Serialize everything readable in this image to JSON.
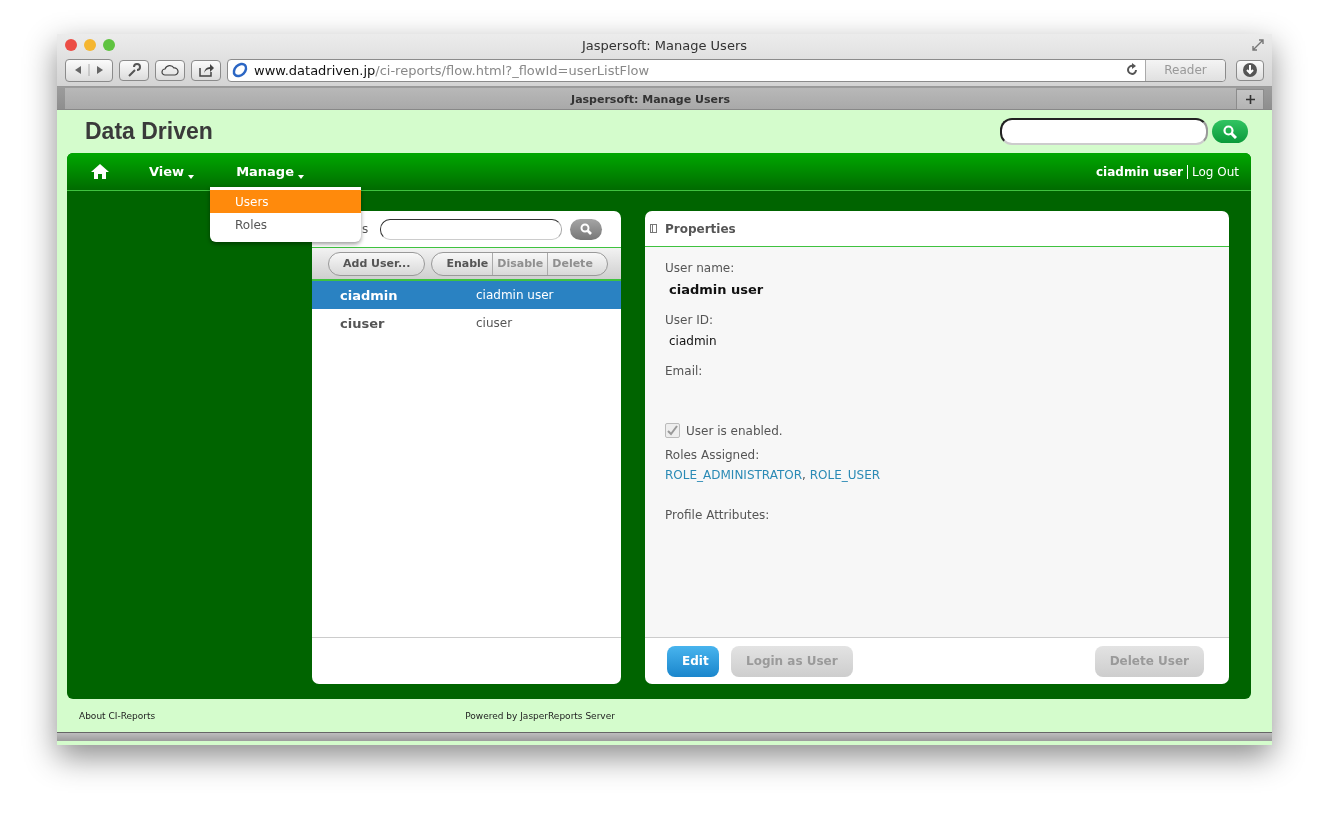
{
  "window": {
    "title": "Jaspersoft: Manage Users"
  },
  "toolbar": {
    "url_host": "www.datadriven.jp",
    "url_path": "/ci-reports/flow.html?_flowId=userListFlow",
    "reader": "Reader"
  },
  "tabs": [
    {
      "label": "Jaspersoft: Manage Users",
      "selected": true
    }
  ],
  "header": {
    "logo": "Data Driven"
  },
  "nav": {
    "items": [
      {
        "label": "View"
      },
      {
        "label": "Manage"
      }
    ],
    "user": "ciadmin user",
    "logout": "Log Out"
  },
  "menu": {
    "items": [
      {
        "label": "Users",
        "selected": true
      },
      {
        "label": "Roles",
        "selected": false
      }
    ]
  },
  "users_panel": {
    "title_fragment": "s",
    "button_groups": [
      [
        {
          "label": "Add User...",
          "disabled": false
        }
      ],
      [
        {
          "label": "Enable",
          "disabled": false
        },
        {
          "label": "Disable",
          "disabled": true
        },
        {
          "label": "Delete",
          "disabled": true
        }
      ]
    ],
    "rows": [
      {
        "id": "ciadmin",
        "name": "ciadmin user",
        "selected": true
      },
      {
        "id": "ciuser",
        "name": "ciuser",
        "selected": false
      }
    ]
  },
  "properties": {
    "title": "Properties",
    "fields": [
      {
        "label": "User name:",
        "value": "ciadmin user"
      },
      {
        "label": "User ID:",
        "value": "ciadmin"
      },
      {
        "label": "Email:"
      }
    ],
    "enabled": {
      "label": "User is enabled.",
      "checked": true
    },
    "roles_label": "Roles Assigned:",
    "roles": [
      "ROLE_ADMINISTRATOR",
      "ROLE_USER"
    ],
    "roles_separator": ",",
    "profile_label": "Profile Attributes:",
    "buttons": [
      {
        "label": "Edit",
        "disabled": false,
        "kind": "primary"
      },
      {
        "label": "Login as User",
        "disabled": true,
        "kind": "secondary"
      },
      {
        "label": "Delete User",
        "disabled": true,
        "kind": "danger"
      }
    ]
  },
  "footer": {
    "left": "About CI-Reports",
    "right": "Powered by JasperReports Server"
  }
}
